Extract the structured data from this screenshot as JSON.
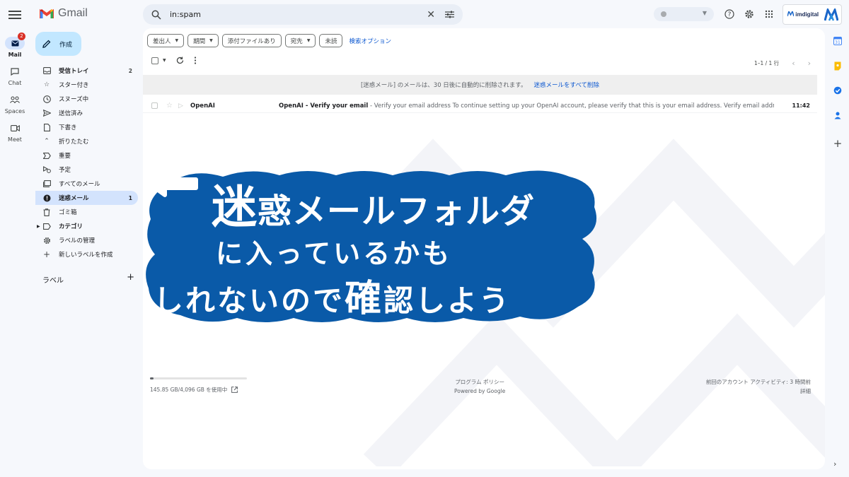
{
  "rail": {
    "items": [
      {
        "label": "Mail",
        "badge": "2"
      },
      {
        "label": "Chat"
      },
      {
        "label": "Spaces"
      },
      {
        "label": "Meet"
      }
    ]
  },
  "logo": {
    "text": "Gmail"
  },
  "search": {
    "value": "in:spam"
  },
  "brand": {
    "text": "imdigital"
  },
  "compose": {
    "label": "作成"
  },
  "nav": {
    "items": [
      {
        "label": "受信トレイ",
        "count": "2",
        "icon": "inbox-icon"
      },
      {
        "label": "スター付き",
        "count": "",
        "icon": "star-icon"
      },
      {
        "label": "スヌーズ中",
        "count": "",
        "icon": "clock-icon"
      },
      {
        "label": "送信済み",
        "count": "",
        "icon": "send-icon"
      },
      {
        "label": "下書き",
        "count": "",
        "icon": "draft-icon"
      },
      {
        "label": "折りたたむ",
        "count": "",
        "icon": "chevron-up-icon"
      },
      {
        "label": "重要",
        "count": "",
        "icon": "important-icon"
      },
      {
        "label": "予定",
        "count": "",
        "icon": "scheduled-icon"
      },
      {
        "label": "すべてのメール",
        "count": "",
        "icon": "all-mail-icon"
      },
      {
        "label": "迷惑メール",
        "count": "1",
        "icon": "spam-icon"
      },
      {
        "label": "ゴミ箱",
        "count": "",
        "icon": "trash-icon"
      },
      {
        "label": "カテゴリ",
        "count": "",
        "icon": "label-icon"
      },
      {
        "label": "ラベルの管理",
        "count": "",
        "icon": "gear-icon"
      },
      {
        "label": "新しいラベルを作成",
        "count": "",
        "icon": "plus-icon"
      }
    ],
    "labels_heading": "ラベル"
  },
  "filters": {
    "chips": [
      "差出人",
      "期間",
      "添付ファイルあり",
      "宛先",
      "未読"
    ],
    "advanced": "検索オプション"
  },
  "pager": {
    "range": "1–1 / 1 行"
  },
  "spam_notice": {
    "text": "[迷惑メール] のメールは、30 日後に自動的に削除されます。",
    "action": "迷惑メールをすべて削除"
  },
  "messages": [
    {
      "sender": "OpenAI",
      "subject": "OpenAI - Verify your email",
      "snippet": " - Verify your email address To continue setting up your OpenAI account, please verify that this is your email address. Verify email address Phone...",
      "time": "11:42"
    }
  ],
  "footer": {
    "storage": "145.85 GB/4,096 GB を使用中",
    "storage_fraction": 0.036,
    "policy": "プログラム ポリシー",
    "powered": "Powered by Google",
    "activity": "前回のアカウント アクティビティ: 3 時間前",
    "details": "詳細"
  },
  "banner": {
    "line1_big": "迷",
    "line1": "惑メールフォルダ",
    "line2": "に入っているかも",
    "line3a": "しれないので",
    "line3_big": "確",
    "line3b": "認しよう"
  },
  "colors": {
    "banner_blue": "#0a5aa8",
    "accent": "#0b57d0",
    "spam_red": "#d93025"
  }
}
